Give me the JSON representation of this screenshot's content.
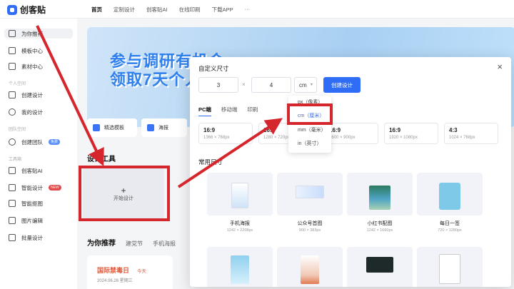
{
  "app": {
    "name": "创客贴"
  },
  "nav": {
    "items": [
      "首页",
      "定制设计",
      "创客贴AI",
      "在线印刷",
      "下载APP"
    ],
    "more": "···"
  },
  "sidebar": {
    "items": {
      "for_you": "为你推荐",
      "templates": "模板中心",
      "assets": "素材中心",
      "create_design": "创建设计",
      "my_designs": "我的设计",
      "create_team": "创建团队",
      "ai": "创客贴AI",
      "smart_design": "智能设计",
      "smart_cutout": "智能抠图",
      "image_edit": "图片编辑",
      "batch_design": "批量设计"
    },
    "sections": {
      "personal": "个人空间",
      "team": "团队空间",
      "toolbox": "工具箱"
    },
    "badges": {
      "team": "免费",
      "smart": "NEW"
    }
  },
  "banner": {
    "line1": "参与调研有机会",
    "line2": "领取7天个人"
  },
  "quick": {
    "q1": "精选模板",
    "q2": "海报"
  },
  "design_tools": {
    "title": "设计工具",
    "start_plus": "+",
    "start_label": "开始设计"
  },
  "recommend": {
    "title": "为你推荐",
    "tab1": "建党节",
    "tab2": "手机海报"
  },
  "holiday": {
    "title": "国际禁毒日",
    "today": "今天",
    "date": "2024.06.26 星期三"
  },
  "modal": {
    "title": "自定义尺寸",
    "close": "×",
    "width": "3",
    "height": "4",
    "times": "×",
    "unit": "cm",
    "create": "创建设计",
    "unit_options": [
      "px（像素）",
      "cm（厘米）",
      "mm（毫米）",
      "in（英寸）"
    ],
    "tabs": [
      "PC端",
      "移动端",
      "印刷"
    ],
    "presets": [
      {
        "ratio": "16:9",
        "dims": "1366 × 768px"
      },
      {
        "ratio": "16:9",
        "dims": "1280 × 720px"
      },
      {
        "ratio": "16:9",
        "dims": "1600 × 900px"
      },
      {
        "ratio": "16:9",
        "dims": "1920 × 1080px"
      },
      {
        "ratio": "4:3",
        "dims": "1024 × 768px"
      }
    ],
    "common": "常用尺寸",
    "templates": [
      {
        "name": "手机海报",
        "size": "1242 × 2208px"
      },
      {
        "name": "公众号首图",
        "size": "900 × 383px"
      },
      {
        "name": "小红书配图",
        "size": "1242 × 1660px"
      },
      {
        "name": "每日一签",
        "size": "720 × 1280px"
      }
    ]
  },
  "colors": {
    "accent": "#2f6df6",
    "annotation_red": "#d6262d"
  },
  "icons": {
    "close": "close-icon",
    "caret": "chevron-down-icon"
  }
}
